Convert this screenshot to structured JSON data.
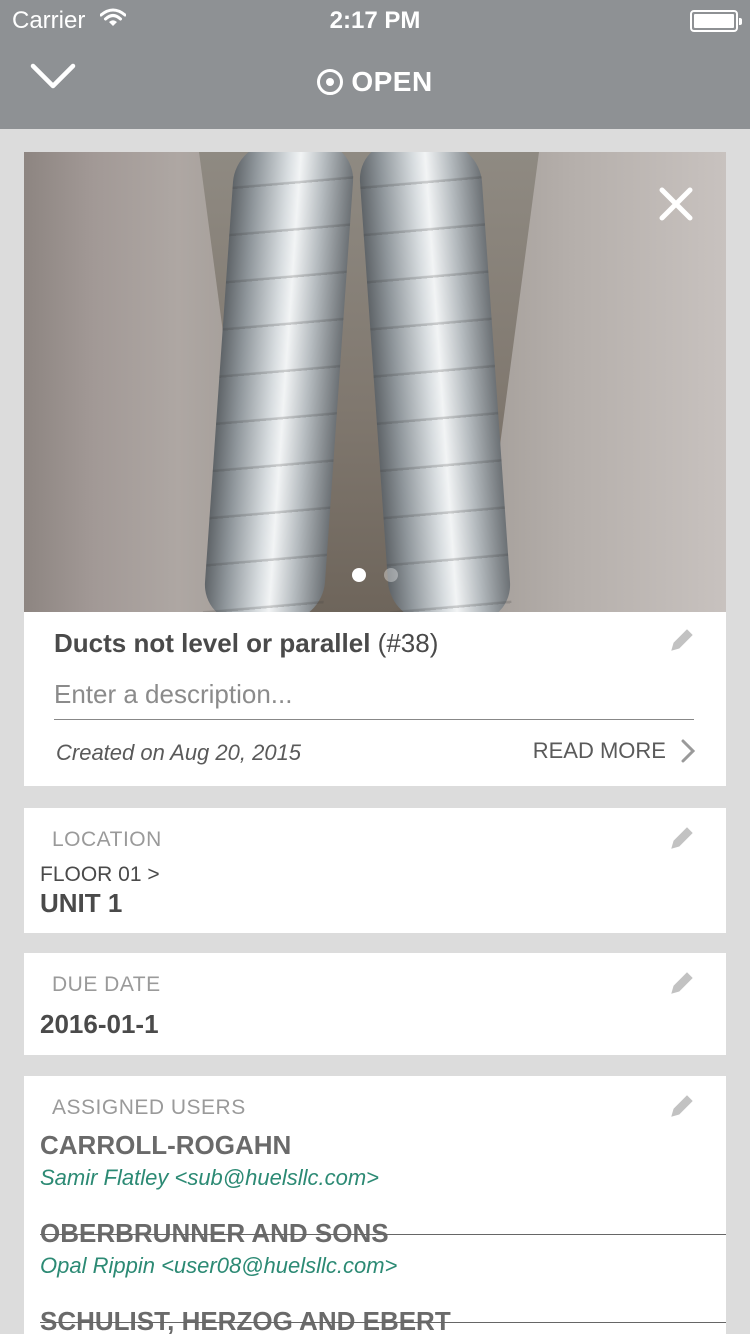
{
  "status_bar": {
    "carrier": "Carrier",
    "time": "2:17 PM"
  },
  "header": {
    "status": "OPEN"
  },
  "photo": {
    "page_count": 2,
    "current_page": 1
  },
  "issue": {
    "title": "Ducts not level or parallel",
    "number": "(#38)",
    "description_placeholder": "Enter a description...",
    "created": "Created on Aug 20, 2015",
    "read_more": "READ MORE"
  },
  "location": {
    "label": "LOCATION",
    "floor": "FLOOR 01 >",
    "unit": "UNIT 1"
  },
  "due_date": {
    "label": "DUE DATE",
    "value": "2016-01-1"
  },
  "assigned": {
    "label": "ASSIGNED USERS",
    "users": [
      {
        "company": "CARROLL-ROGAHN",
        "contact": "Samir Flatley <sub@huelsllc.com>"
      },
      {
        "company": "OBERBRUNNER AND SONS",
        "contact": "Opal Rippin <user08@huelsllc.com>"
      },
      {
        "company": "SCHULIST, HERZOG AND EBERT",
        "contact": ""
      }
    ]
  },
  "colors": {
    "header_bg": "#8e9194",
    "contact_text": "#2c8a74",
    "background": "#dcdcdc"
  }
}
